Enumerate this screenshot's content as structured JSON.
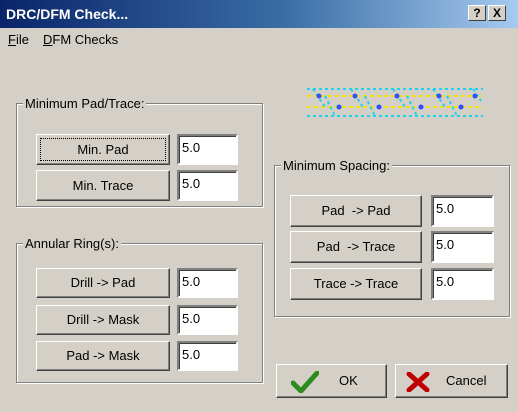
{
  "window": {
    "title": "DRC/DFM Check...",
    "help_label": "?",
    "close_label": "X"
  },
  "menu": [
    {
      "label": "File",
      "accel": "F",
      "rest": "ile"
    },
    {
      "label": "DFM Checks",
      "accel": "D",
      "rest": "FM Checks"
    }
  ],
  "min_pad_trace": {
    "label": "Minimum Pad/Trace:",
    "rows": [
      {
        "button": "Min. Pad",
        "value": "5.0"
      },
      {
        "button": "Min. Trace",
        "value": "5.0"
      }
    ]
  },
  "annular_ring": {
    "label": "Annular Ring(s):",
    "rows": [
      {
        "button": "Drill -> Pad",
        "value": "5.0"
      },
      {
        "button": "Drill -> Mask",
        "value": "5.0"
      },
      {
        "button": "Pad -> Mask",
        "value": "5.0"
      }
    ]
  },
  "min_spacing": {
    "label": "Minimum Spacing:",
    "rows": [
      {
        "button": "Pad  -> Pad",
        "value": "5.0"
      },
      {
        "button": "Pad  -> Trace",
        "value": "5.0"
      },
      {
        "button": "Trace -> Trace",
        "value": "5.0"
      }
    ]
  },
  "actions": {
    "ok": {
      "label": "OK",
      "icon": "checkmark-icon",
      "color": "#2e8b1e"
    },
    "cancel": {
      "label": "Cancel",
      "icon": "x-mark-icon",
      "color": "#c00000"
    }
  },
  "preview": {
    "icon": "trace-pattern-icon",
    "colors": {
      "trace": "#f5e10a",
      "pad": "#1fd3e8",
      "marker": "#3050ff"
    }
  }
}
